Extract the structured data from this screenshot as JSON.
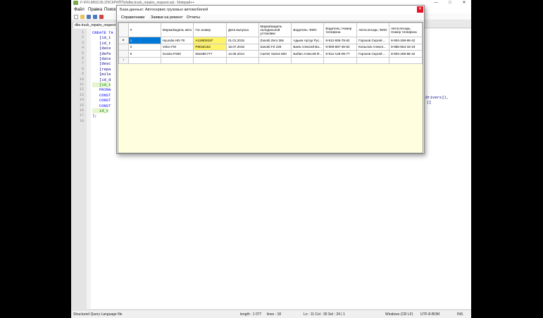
{
  "editor": {
    "title": "F:\\FFLM\\03.06.20\\СКРИПТЫ\\dbo.truck_repairs_request.sql - Notepad++",
    "menu": [
      "Файл",
      "Правка",
      "Поиск"
    ],
    "tab": "dbo.truck_repairs_request",
    "line_numbers": [
      "1",
      "2",
      "3",
      "4",
      "5",
      "6",
      "7",
      "8",
      "9",
      "10",
      "11",
      "12",
      "13",
      "14",
      "15",
      "16",
      "17",
      "18"
    ],
    "code": [
      "CREATE TA",
      "   [id_t",
      "   [id_t",
      "   [date",
      "   [defe",
      "   [date",
      "   [desc",
      "   [repa",
      "   [mile",
      "   [id_d",
      "   [id_t",
      "   PRIMA",
      "   CONST",
      "   CONST",
      "   CONST",
      "   id_t",
      ");",
      ""
    ],
    "code_right_1": "drivers]),",
    "code_right_2": "([",
    "status": {
      "filetype": "Structured Query Language file",
      "length": "length : 1 077",
      "lines": "lines : 18",
      "pos": "Ln : 11    Col : 30    Sel : 24 | 1",
      "eol": "Windows (CR LF)",
      "enc": "UTF-8-BOM",
      "ins": "INS"
    }
  },
  "dialog": {
    "title": "База данных: Автосервис грузовых автомобилей",
    "menu": [
      "Справочники",
      "Заявки на ремонт",
      "Отчеты"
    ],
    "columns": [
      "#",
      "Марка/модель авто",
      "Гос.номер",
      "Дата выпуска",
      "Марка/модель холодильной установки",
      "Водитель: ФИО",
      "Водитель: Номер телефона",
      "Автослесарь: ФИО",
      "Автослесарь: Номер телефона"
    ],
    "rows": [
      [
        "1",
        "Hyundai HD-78",
        "А119ЕМ197",
        "01.01.2015",
        "Zanotti Zero 38s",
        "Адыев Артур Рус...",
        "8-912-555-78-62",
        "Горохов Сергей ...",
        "8-904-258-86-42"
      ],
      [
        "2",
        "Volvo FM",
        "Р801Е162",
        "16.07.2015",
        "Zanotti FZ 248",
        "Баев Алексей Ва...",
        "8-909-887-36-52",
        "Копылов Алексе...",
        "8-965-654-18-19"
      ],
      [
        "5",
        "Scania P250",
        "К822ВА777",
        "12.06.2014",
        "Carrier Xarios 600",
        "Бабин Алексей Ф...",
        "8-912-125-08-77",
        "Горохов Сергей ...",
        "8-904-258-86-42"
      ]
    ],
    "current_marker": "▸",
    "new_row_marker": "*"
  }
}
